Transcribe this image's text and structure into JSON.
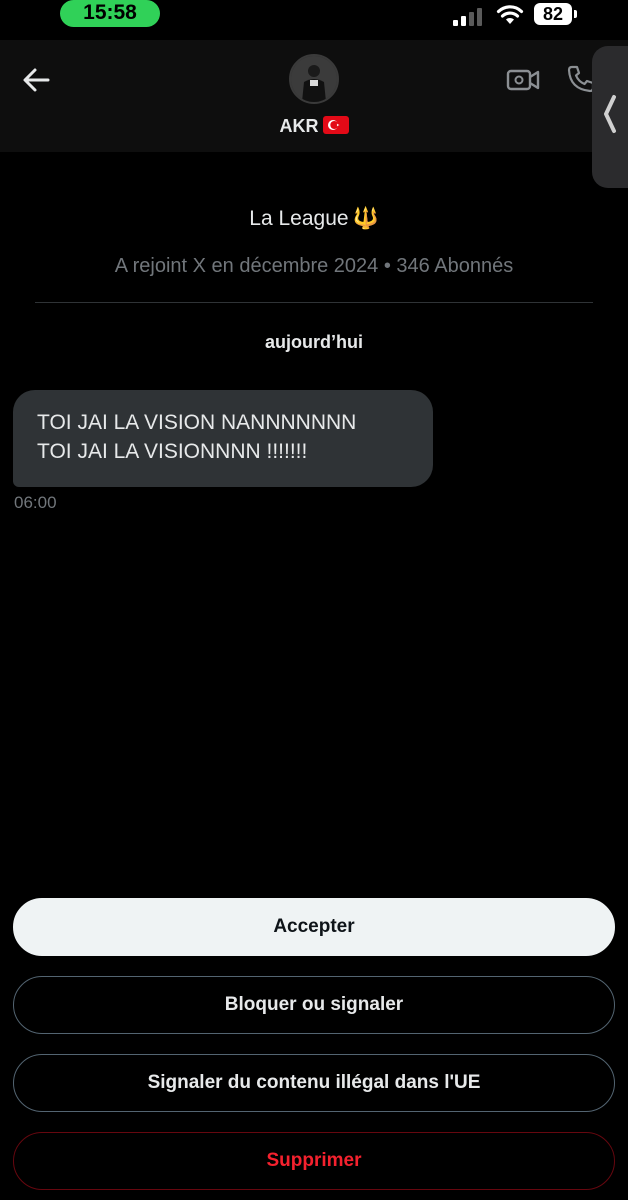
{
  "status_bar": {
    "time": "15:58",
    "battery": "82",
    "time_pill_color": "#30d158",
    "signal_icon": "cellular-signal-icon",
    "wifi_icon": "wifi-icon"
  },
  "header": {
    "name": "AKR",
    "flag_icon": "turkey-flag-icon",
    "back_icon": "arrow-left-icon",
    "video_icon": "video-call-icon",
    "phone_icon": "phone-icon",
    "side_handle_icon": "chevron-left-icon"
  },
  "profile": {
    "title": "La League",
    "title_emoji": "🔱",
    "meta": "A rejoint X en décembre 2024 • 346 Abonnés"
  },
  "conversation": {
    "date_label": "aujourd’hui",
    "messages": [
      {
        "lines": [
          "TOI JAI LA VISION NANNNNNNN",
          "TOI JAI LA VISIONNNN !!!!!!!"
        ],
        "time": "06:00"
      }
    ]
  },
  "actions": {
    "accept": "Accepter",
    "block_or_report": "Bloquer ou signaler",
    "report_illegal": "Signaler du contenu illégal dans l'UE",
    "delete": "Supprimer"
  },
  "colors": {
    "background": "#000000",
    "header_background": "#0e0e0e",
    "bubble": "#2f3336",
    "muted_text": "#71767b",
    "danger": "#f4212e",
    "accept_button": "#eff3f4"
  }
}
